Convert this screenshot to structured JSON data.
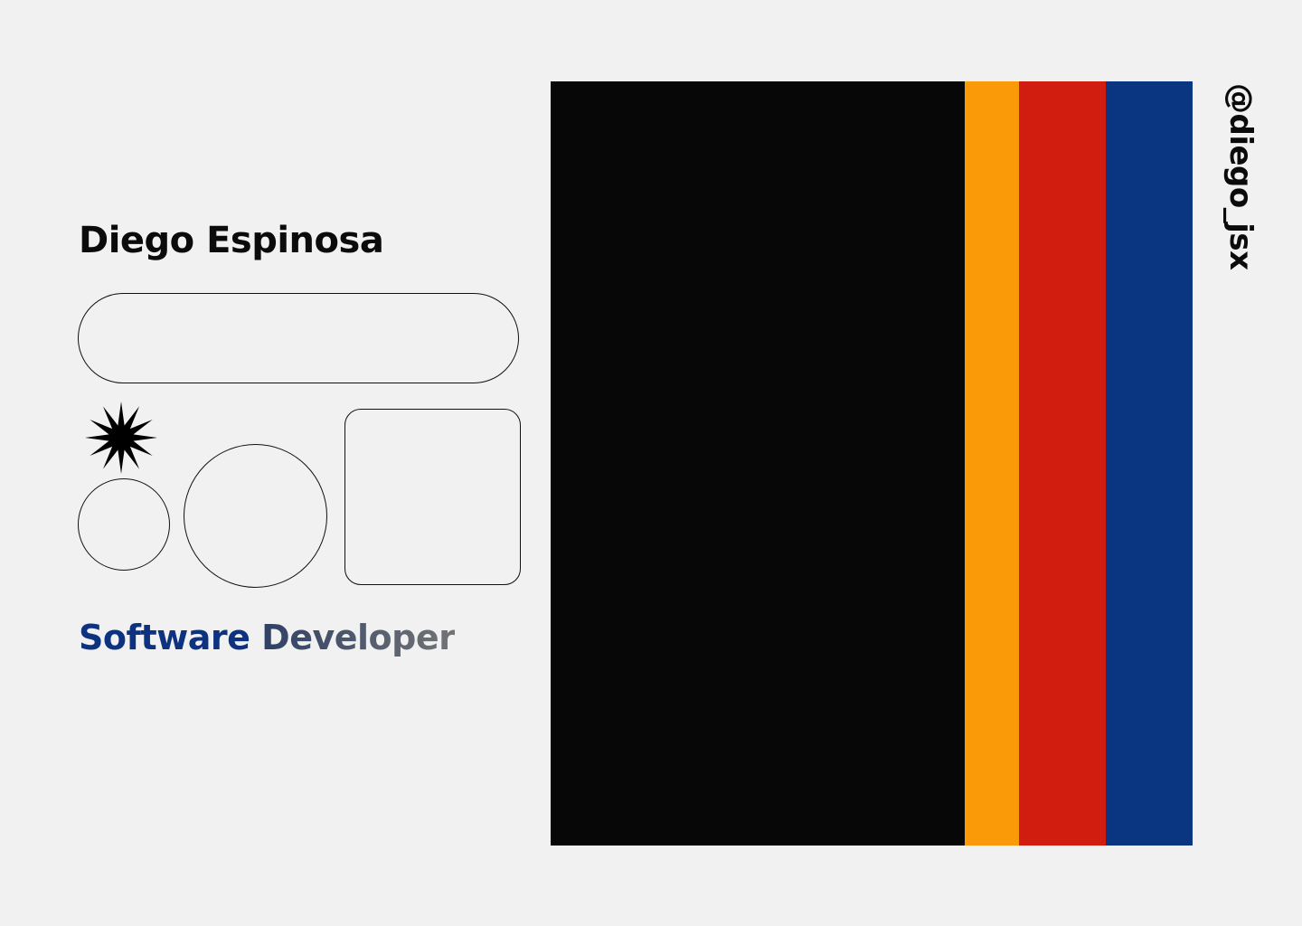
{
  "profile": {
    "name": "Diego Espinosa",
    "role_first": "Software",
    "role_second": "Developer",
    "handle": "@diego_jsx"
  },
  "shapes": {
    "starburst_icon": "starburst-icon",
    "outline_color": "#111111"
  },
  "colors": {
    "background": "#f2f1f2",
    "text": "#0b0b0b",
    "role_accent": "#0d3380",
    "role_secondary": "#4b5563",
    "stripe_black": "#070707",
    "stripe_orange": "#fb9a08",
    "stripe_red": "#d11d0f",
    "stripe_blue": "#0a3580"
  }
}
